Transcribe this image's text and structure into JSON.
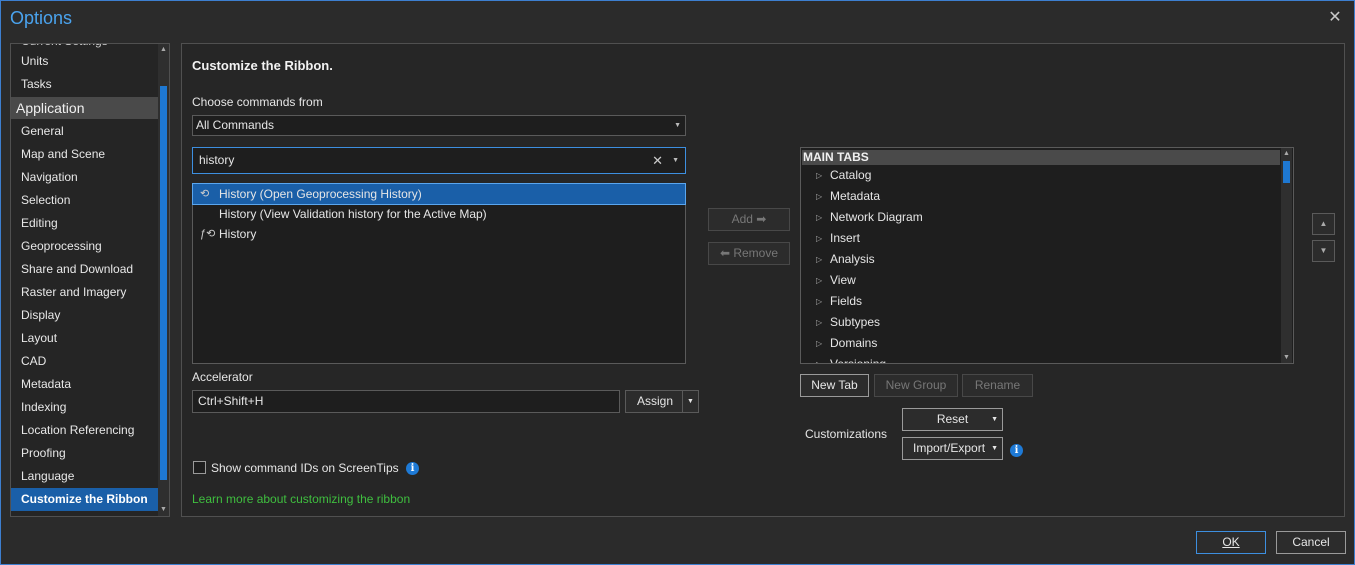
{
  "window": {
    "title": "Options",
    "close_glyph": "✕"
  },
  "nav": {
    "items_before": [
      "Current Settings",
      "Units",
      "Tasks"
    ],
    "group": "Application",
    "items": [
      "General",
      "Map and Scene",
      "Navigation",
      "Selection",
      "Editing",
      "Geoprocessing",
      "Share and Download",
      "Raster and Imagery",
      "Display",
      "Layout",
      "CAD",
      "Metadata",
      "Indexing",
      "Location Referencing",
      "Proofing",
      "Language",
      "Customize the Ribbon"
    ],
    "selected": "Customize the Ribbon"
  },
  "panel": {
    "heading": "Customize the Ribbon.",
    "choose_label": "Choose commands from",
    "choose_value": "All Commands",
    "search_value": "history",
    "search_clear_glyph": "✕",
    "results": [
      {
        "label": "History (Open Geoprocessing History)",
        "icon": "geoprocessing-history-icon",
        "glyph": "⟲",
        "selected": true
      },
      {
        "label": "History (View Validation history for the Active Map)",
        "icon": "",
        "glyph": "",
        "selected": false
      },
      {
        "label": "History",
        "icon": "fx-history-icon",
        "glyph": "ƒ⟲",
        "selected": false
      }
    ],
    "add_label": "Add ➡",
    "remove_label": "⬅ Remove",
    "accelerator_label": "Accelerator",
    "accelerator_value": "Ctrl+Shift+H",
    "assign_label": "Assign",
    "show_ids_label": "Show command IDs on ScreenTips",
    "learn_more": "Learn more about customizing the ribbon",
    "tree_header": "MAIN TABS",
    "tree_items": [
      "Catalog",
      "Metadata",
      "Network Diagram",
      "Insert",
      "Analysis",
      "View",
      "Fields",
      "Subtypes",
      "Domains",
      "Versioning"
    ],
    "new_tab_label": "New Tab",
    "new_group_label": "New Group",
    "rename_label": "Rename",
    "customizations_label": "Customizations",
    "reset_label": "Reset",
    "import_export_label": "Import/Export"
  },
  "footer": {
    "ok_label": "OK",
    "cancel_label": "Cancel"
  },
  "colors": {
    "accent": "#1e78d2",
    "link": "#3fbf3f",
    "title": "#4aa3ee"
  }
}
